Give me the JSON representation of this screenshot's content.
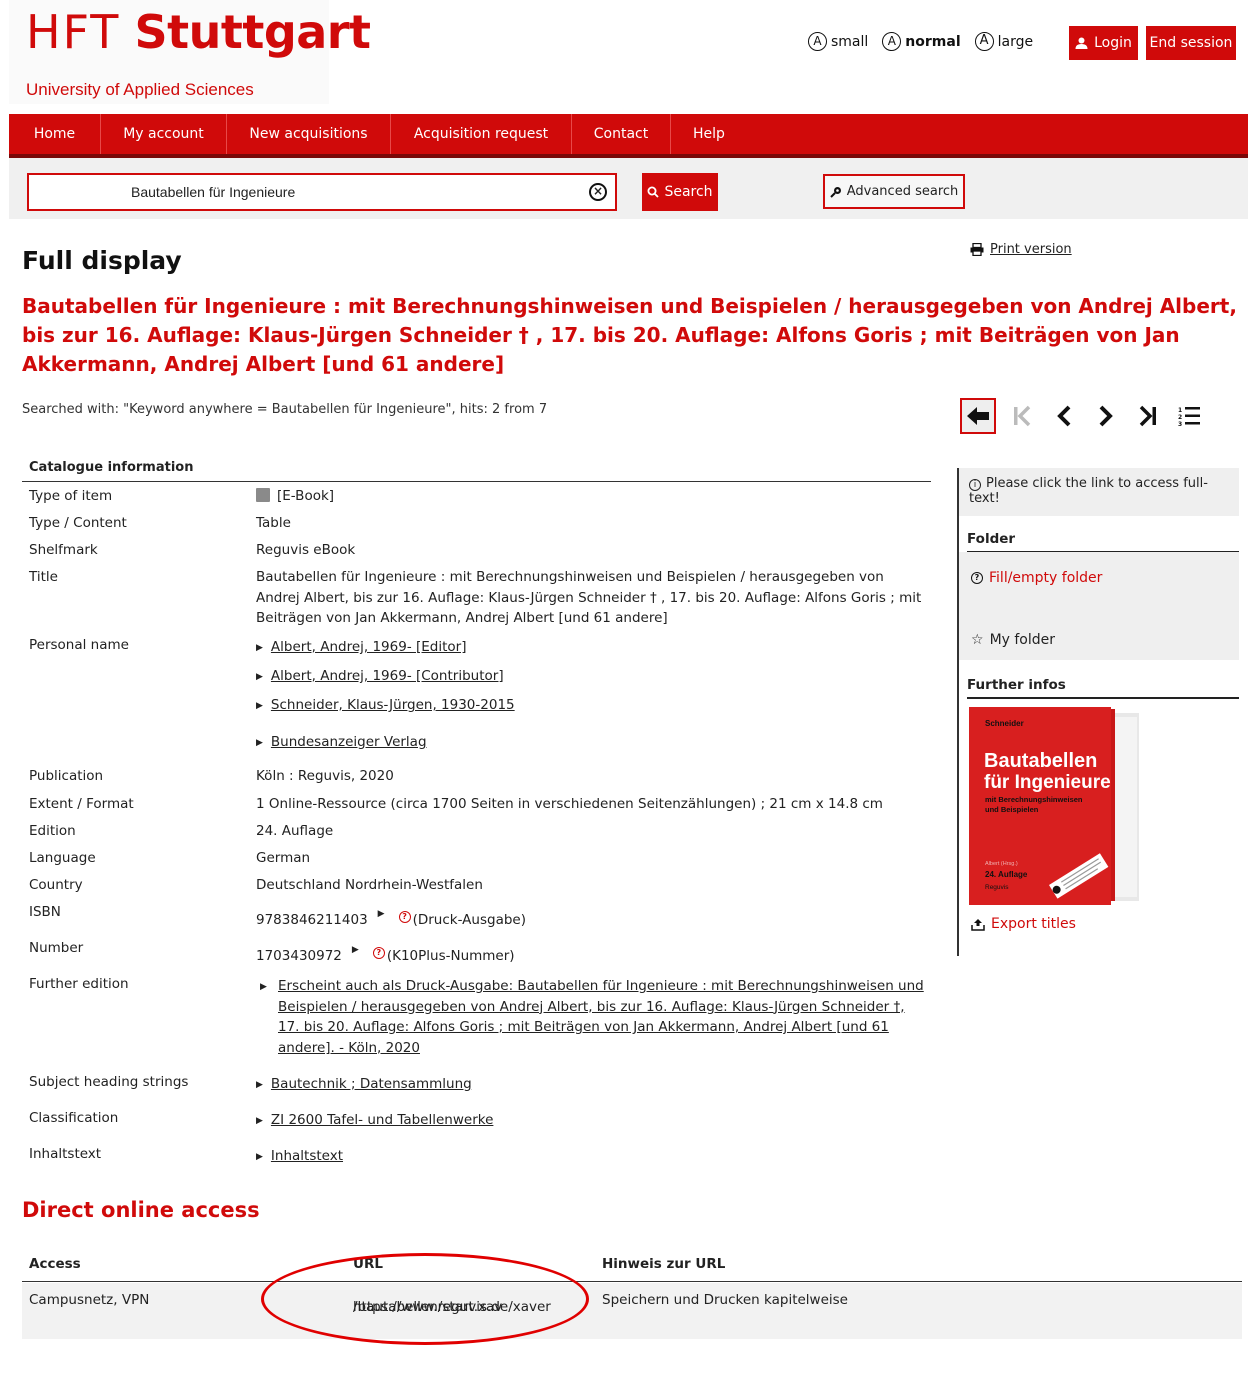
{
  "header": {
    "logo_hft": "HFT",
    "logo_stuttgart": "Stuttgart",
    "logo_subtitle": "University of Applied Sciences",
    "font_sizes": [
      {
        "icon": "A",
        "label": "small"
      },
      {
        "icon": "A",
        "label": "normal"
      },
      {
        "icon": "A",
        "label": "large"
      }
    ],
    "login_label": "Login",
    "end_session_label": "End session"
  },
  "nav": {
    "items": [
      "Home",
      "My account",
      "New acquisitions",
      "Acquisition request",
      "Contact",
      "Help"
    ]
  },
  "search": {
    "value": "Bautabellen für Ingenieure",
    "search_label": "Search",
    "advanced_label": "Advanced search"
  },
  "main": {
    "page_title": "Full display",
    "print_label": "Print version",
    "record_title": "Bautabellen für Ingenieure : mit Berechnungshinweisen und Beispielen / herausgegeben von Andrej Albert, bis zur 16. Auflage: Klaus-Jürgen Schneider † , 17. bis 20. Auflage: Alfons Goris ; mit Beiträgen von Jan Akkermann, Andrej Albert [und 61 andere]",
    "searched_with": "Searched with: \"Keyword anywhere = Bautabellen für Ingenieure\", hits: 2 from 7",
    "catalogue_heading": "Catalogue information",
    "fields": {
      "type_item_label": "Type of item",
      "type_item_value": "[E-Book]",
      "type_content_label": "Type / Content",
      "type_content_value": "Table",
      "shelfmark_label": "Shelfmark",
      "shelfmark_value": "Reguvis eBook",
      "title_label": "Title",
      "title_value": "Bautabellen für Ingenieure : mit Berechnungshinweisen und Beispielen / herausgegeben von Andrej Albert, bis zur 16. Auflage: Klaus-Jürgen Schneider † , 17. bis 20. Auflage: Alfons Goris ; mit Beiträgen von Jan Akkermann, Andrej Albert [und 61 andere]",
      "personal_label": "Personal name",
      "personal_values": [
        "Albert, Andrej, 1969- [Editor]",
        "Albert, Andrej, 1969- [Contributor]",
        "Schneider, Klaus-Jürgen, 1930-2015",
        "Bundesanzeiger Verlag"
      ],
      "publication_label": "Publication",
      "publication_value": "Köln : Reguvis, 2020",
      "extent_label": "Extent / Format",
      "extent_value": "1 Online-Ressource (circa 1700 Seiten in verschiedenen Seitenzählungen) ; 21 cm x 14.8 cm",
      "edition_label": "Edition",
      "edition_value": "24. Auflage",
      "language_label": "Language",
      "language_value": "German",
      "country_label": "Country",
      "country_value": "Deutschland Nordrhein-Westfalen",
      "isbn_label": "ISBN",
      "isbn_value": "9783846211403",
      "isbn_note": "(Druck-Ausgabe)",
      "number_label": "Number",
      "number_value": "1703430972",
      "number_note": "(K10Plus-Nummer)",
      "further_label": "Further edition",
      "further_value": "Erscheint auch als Druck-Ausgabe: Bautabellen für Ingenieure : mit Berechnungshinweisen und Beispielen / herausgegeben von Andrej Albert, bis zur 16. Auflage: Klaus-Jürgen Schneider †, 17. bis 20. Auflage: Alfons Goris ; mit Beiträgen von Jan Akkermann, Andrej Albert [und 61 andere]. - Köln, 2020",
      "subject_label": "Subject heading strings",
      "subject_value": "Bautechnik ; Datensammlung",
      "classification_label": "Classification",
      "classification_value": "ZI 2600 Tafel- und Tabellenwerke",
      "inhalt_label": "Inhaltstext",
      "inhalt_value": "Inhaltstext"
    }
  },
  "sidebar": {
    "note": "Please click the link to access full-text!",
    "folder_heading": "Folder",
    "fill_folder": "Fill/empty folder",
    "my_folder": "My folder",
    "further_heading": "Further infos",
    "export_label": "Export titles",
    "cover": {
      "author": "Schneider",
      "title_line1": "Bautabellen",
      "title_line2": "für Ingenieure",
      "subtitle_line1": "mit Berechnungshinweisen",
      "subtitle_line2": "und Beispielen",
      "editor": "Albert (Hrsg.)",
      "edition": "24. Auflage",
      "publisher": "Reguvis"
    }
  },
  "direct_access": {
    "title": "Direct online access",
    "col_access": "Access",
    "col_url": "URL",
    "col_note": "Hinweis zur URL",
    "access_value": "Campusnetz, VPN",
    "url_line1": "https://www.reguvis.de/xaver",
    "url_line2": "/bautabellen/start.xav",
    "note_value": "Speichern und Drucken kapitelweise"
  },
  "colors": {
    "brand_red": "#d00a0a",
    "annotation_red": "#e00000"
  }
}
